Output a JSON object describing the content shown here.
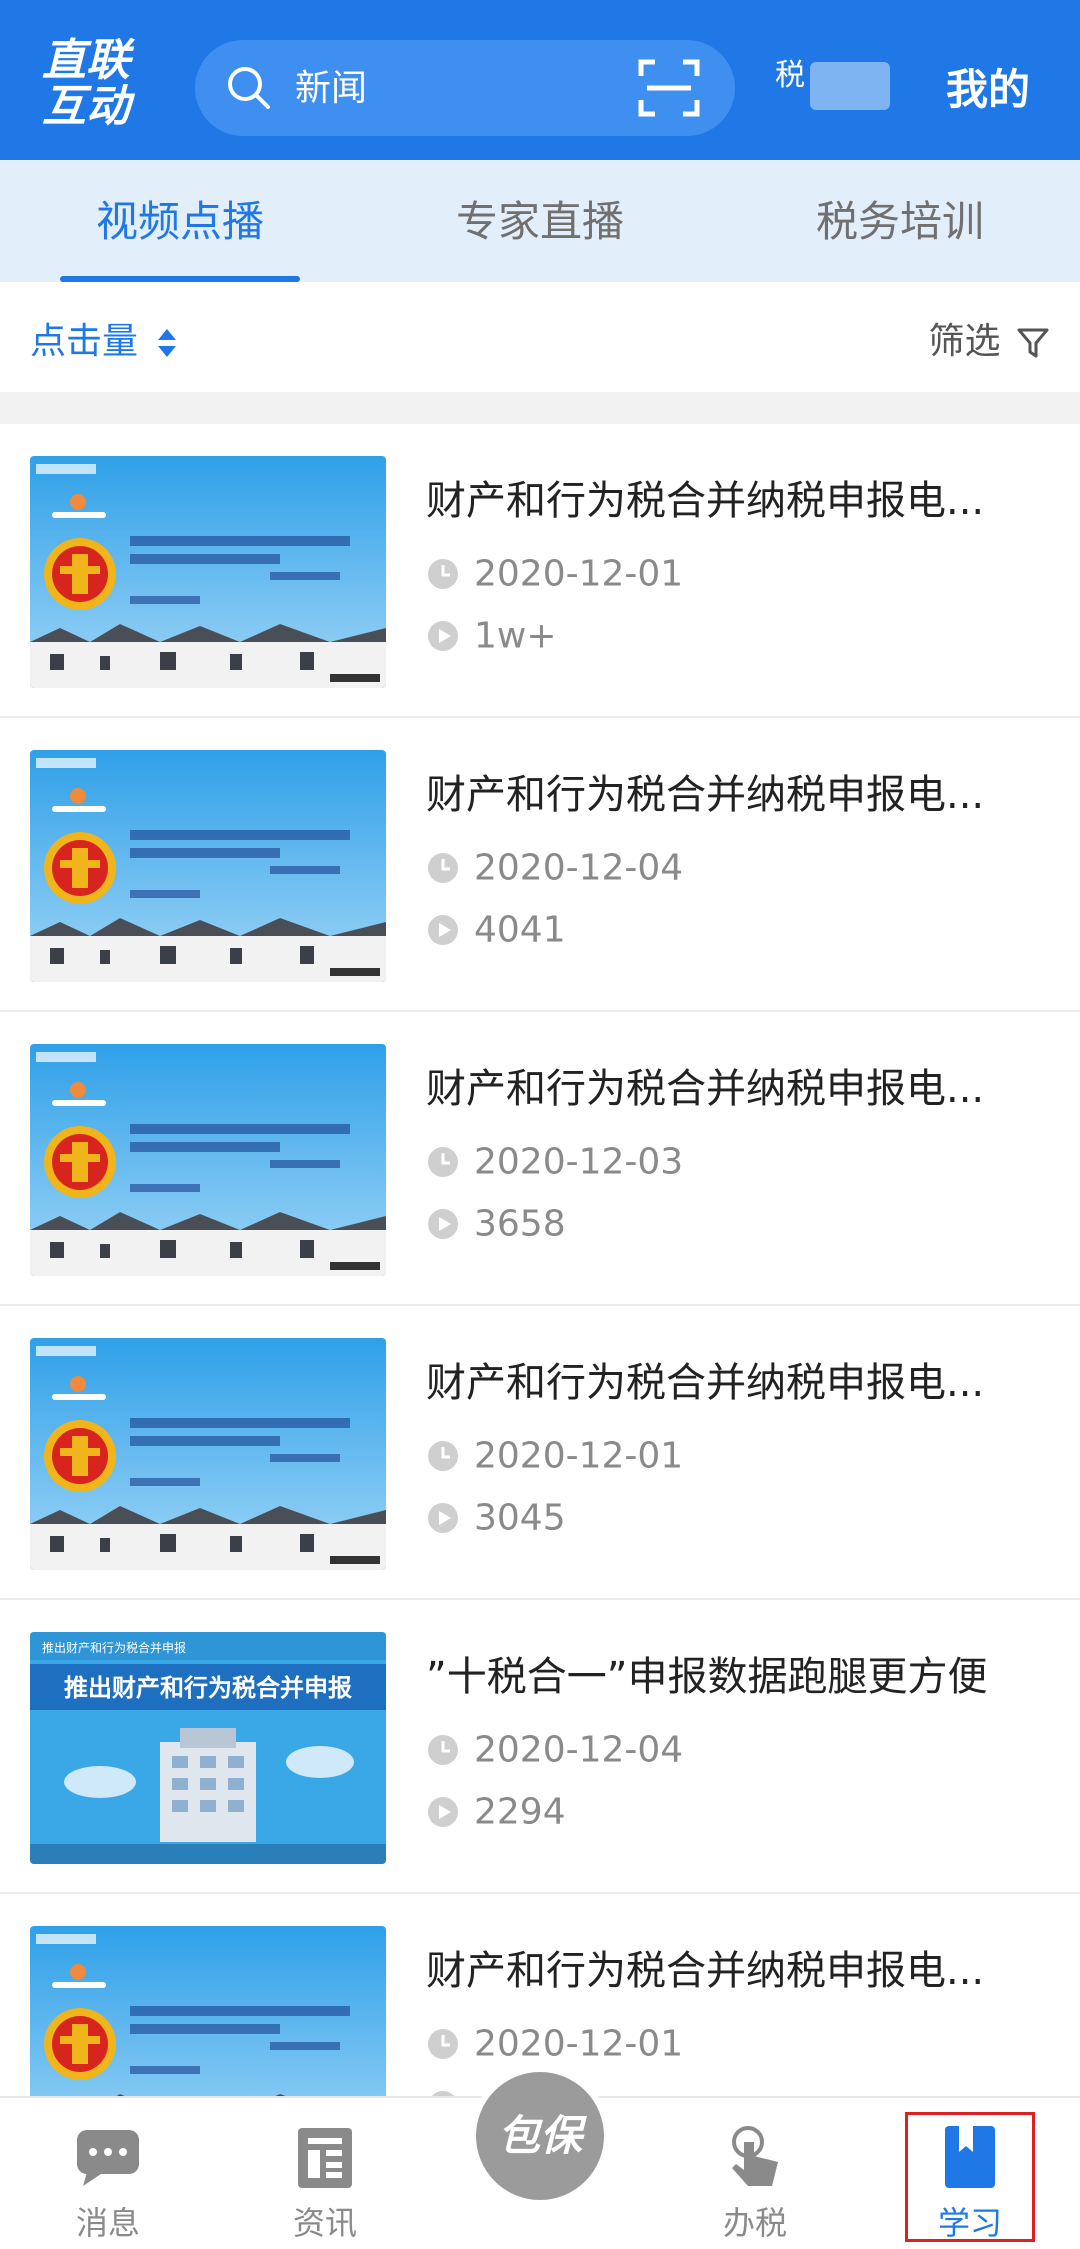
{
  "header": {
    "logo": "直联互动",
    "search_text": "新闻",
    "region_char": "税",
    "mine_label": "我的",
    "accent": "#1f78e6"
  },
  "tabs": [
    {
      "label": "视频点播",
      "active": true
    },
    {
      "label": "专家直播",
      "active": false
    },
    {
      "label": "税务培训",
      "active": false
    }
  ],
  "sort": {
    "label": "点击量",
    "icon": "sort-arrows-icon"
  },
  "filter": {
    "label": "筛选",
    "icon": "filter-funnel-icon"
  },
  "videos": [
    {
      "title": "财产和行为税合并纳税申报电...",
      "date": "2020-12-01",
      "views": "1w+",
      "thumb": "tax-emblem"
    },
    {
      "title": "财产和行为税合并纳税申报电...",
      "date": "2020-12-04",
      "views": "4041",
      "thumb": "tax-emblem"
    },
    {
      "title": "财产和行为税合并纳税申报电...",
      "date": "2020-12-03",
      "views": "3658",
      "thumb": "tax-emblem"
    },
    {
      "title": "财产和行为税合并纳税申报电...",
      "date": "2020-12-01",
      "views": "3045",
      "thumb": "tax-emblem"
    },
    {
      "title": "”十税合一”申报数据跑腿更方便",
      "date": "2020-12-04",
      "views": "2294",
      "thumb": "building",
      "thumb_caption": "推出财产和行为税合并申报"
    },
    {
      "title": "财产和行为税合并纳税申报电...",
      "date": "2020-12-01",
      "views": "",
      "thumb": "tax-emblem"
    }
  ],
  "navbar": {
    "items": [
      {
        "label": "消息",
        "icon": "chat-bubble-icon",
        "active": false
      },
      {
        "label": "资讯",
        "icon": "news-icon",
        "active": false
      },
      {
        "label": "办税",
        "icon": "hand-tap-icon",
        "active": false
      },
      {
        "label": "学习",
        "icon": "bookmark-book-icon",
        "active": true
      }
    ],
    "center_label": "包保"
  }
}
